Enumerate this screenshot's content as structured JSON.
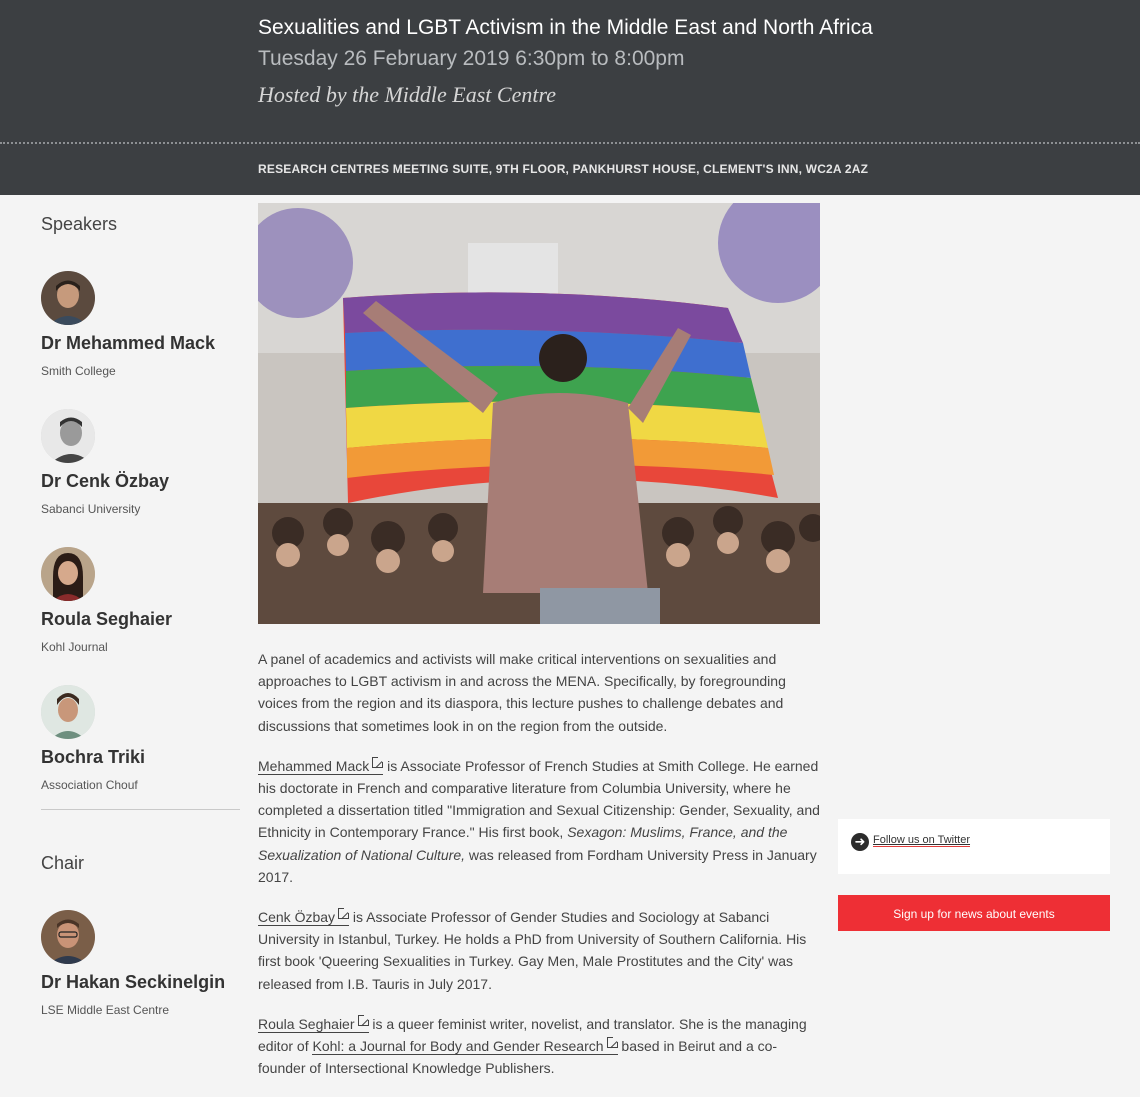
{
  "event": {
    "title": "Sexualities and LGBT Activism in the Middle East and North Africa",
    "datetime": "Tuesday 26 February 2019 6:30pm to 8:00pm",
    "host": "Hosted by the Middle East Centre",
    "venue": "RESEARCH CENTRES MEETING SUITE, 9TH FLOOR, PANKHURST HOUSE, CLEMENT'S INN, WC2A 2AZ"
  },
  "sidebar": {
    "speakers_heading": "Speakers",
    "speakers": [
      {
        "name": "Dr Mehammed Mack",
        "affiliation": "Smith College"
      },
      {
        "name": "Dr Cenk Özbay",
        "affiliation": "Sabanci University"
      },
      {
        "name": "Roula Seghaier",
        "affiliation": "Kohl Journal"
      },
      {
        "name": "Bochra Triki",
        "affiliation": "Association Chouf"
      }
    ],
    "chair_heading": "Chair",
    "chair": {
      "name": "Dr Hakan Seckinelgin",
      "affiliation": "LSE Middle East Centre"
    }
  },
  "intro": "A panel of academics and activists will make critical interventions on sexualities and approaches to LGBT activism in and across the MENA. Specifically, by foregrounding voices from the region and its diaspora, this lecture pushes to challenge debates and discussions that sometimes look in on the region from the outside.",
  "bios": {
    "mack": {
      "link": "Mehammed Mack",
      "text1": " is Associate Professor of French Studies at Smith College. He earned his doctorate in French and comparative literature from Columbia University, where he completed a dissertation titled \"Immigration and Sexual Citizenship: Gender, Sexuality, and Ethnicity in Contemporary France.\" His first book, ",
      "book": "Sexagon: Muslims, France, and the Sexualization of National Culture,",
      "text2": " was released from Fordham University Press in January 2017."
    },
    "ozbay": {
      "link": "Cenk Özbay",
      "text": " is Associate Professor of Gender Studies and Sociology at Sabanci University in Istanbul, Turkey. He holds a PhD from University of Southern California. His first book 'Queering Sexualities in Turkey. Gay Men, Male Prostitutes and the City' was released from I.B. Tauris in July 2017."
    },
    "seghaier": {
      "link": "Roula Seghaier",
      "text1": " is a queer feminist writer, novelist, and translator. She is the managing editor of ",
      "link2": "Kohl: a Journal for Body and Gender Research",
      "text2": " based in Beirut and a co-founder of Intersectional Knowledge Publishers."
    }
  },
  "aside": {
    "twitter_label": "Follow us on Twitter",
    "signup_label": "Sign up for news about events"
  },
  "colors": {
    "header_bg": "#3c3f42",
    "page_bg": "#f4f4f4",
    "signup_bg": "#ee2f35"
  }
}
